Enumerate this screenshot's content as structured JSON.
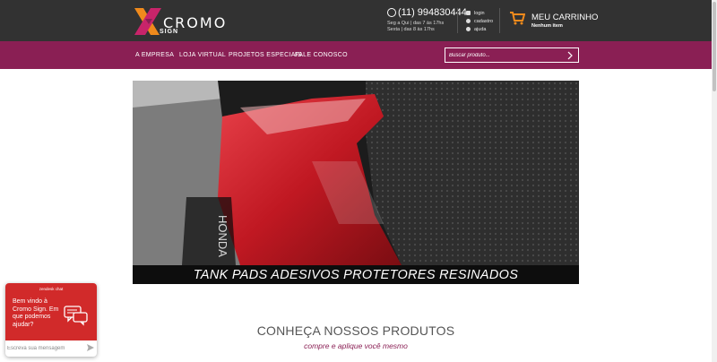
{
  "brand": {
    "name": "CROMO",
    "sub": "SIGN"
  },
  "contact": {
    "phone": "(11) 994830444",
    "hours_line1": "Seg a Qui | das 7 às 17hs",
    "hours_line2": "Sexta | das 8 às 17hs"
  },
  "account": {
    "items": [
      {
        "label": "login",
        "icon": "login-icon"
      },
      {
        "label": "cadastro",
        "icon": "register-icon"
      },
      {
        "label": "ajuda",
        "icon": "help-icon"
      }
    ]
  },
  "cart": {
    "title": "MEU CARRINHO",
    "status": "Nenhum item",
    "accent": "#f08a1c"
  },
  "nav": {
    "items": [
      "A EMPRESA",
      "LOJA VIRTUAL",
      "PROJETOS ESPECIAIS",
      "FALE CONOSCO"
    ]
  },
  "search": {
    "placeholder": "Buscar produto..."
  },
  "hero": {
    "caption": "TANK PADS  ADESIVOS  PROTETORES  RESINADOS",
    "photo_text": "HONDA"
  },
  "section": {
    "title": "CONHEÇA NOSSOS PRODUTOS",
    "subtitle": "compre e aplique você mesmo"
  },
  "chat": {
    "brand": "zendesk chat",
    "message": "Bem vindo à Cromo Sign. Em que podemos ajudar?",
    "placeholder": "Escreva sua mensagem"
  },
  "colors": {
    "header_bg": "#323232",
    "nav_bg": "#8a1f54",
    "chat_bg": "#d12a2a"
  }
}
